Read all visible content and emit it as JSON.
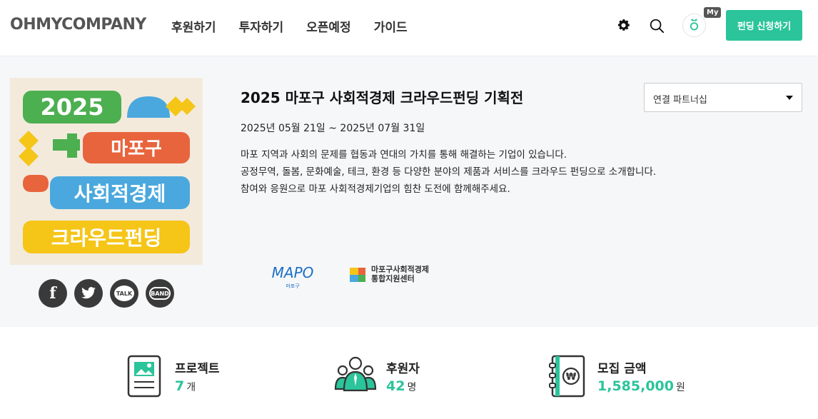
{
  "header": {
    "logo_text": "OHMYCOMPANY",
    "nav": [
      "후원하기",
      "투자하기",
      "오픈예정",
      "가이드"
    ],
    "my_badge": "My",
    "cta_label": "펀딩 신청하기"
  },
  "project": {
    "title": "2025 마포구 사회적경제 크라우드펀딩 기획전",
    "dates": "2025년 05월 21일 ~ 2025년 07월 31일",
    "description": [
      "마포 지역과 사회의 문제를 협동과 연대의 가치를 통해 해결하는 기업이 있습니다.",
      "공정무역, 돌봄, 문화예술, 테크, 환경 등 다양한 분야의 제품과 서비스를 크라우드 펀딩으로 소개합니다.",
      "참여와 응원으로 마포 사회적경제기업의 힘찬 도전에 함께해주세요."
    ],
    "partner_select": "연결 파트너십",
    "poster": {
      "year": "2025",
      "line1": "마포구",
      "line2": "사회적경제",
      "line3": "크라우드펀딩"
    },
    "partners": {
      "mapo_logo": "MAPO",
      "mapo_sub": "마포구",
      "center_line1": "마포구사회적경제",
      "center_line2": "통합지원센터"
    }
  },
  "social": {
    "kakao": "TALK",
    "band": "BAND"
  },
  "stats": {
    "projects_label": "프로젝트",
    "projects_value": "7",
    "projects_unit": "개",
    "backers_label": "후원자",
    "backers_value": "42",
    "backers_unit": "명",
    "amount_label": "모집 금액",
    "amount_value": "1,585,000",
    "amount_unit": "원"
  },
  "colors": {
    "accent": "#2bc49b",
    "poster_bg": "#f3eadc",
    "poster_green": "#4caf50",
    "poster_orange": "#e8643c",
    "poster_blue": "#4aa8de",
    "poster_yellow": "#f5c518"
  }
}
